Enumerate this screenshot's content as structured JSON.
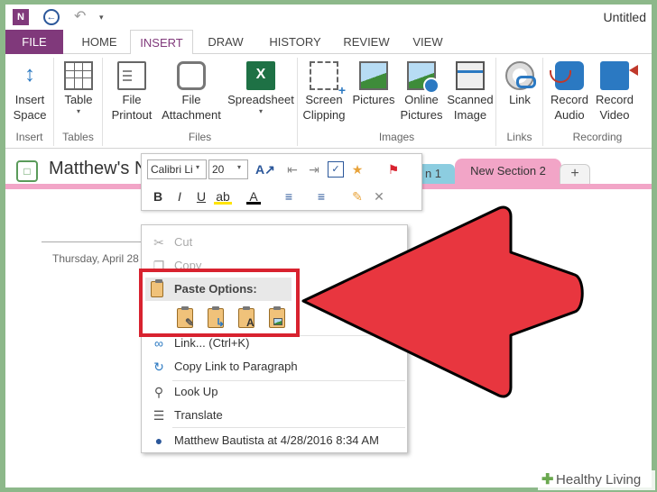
{
  "app": {
    "logo": "N",
    "title": "Untitled"
  },
  "tabs": [
    "FILE",
    "HOME",
    "INSERT",
    "DRAW",
    "HISTORY",
    "REVIEW",
    "VIEW"
  ],
  "ribbon": {
    "groups": {
      "insert": "Insert",
      "tables": "Tables",
      "files": "Files",
      "images": "Images",
      "links": "Links",
      "recording": "Recording"
    },
    "buttons": {
      "insert_space": [
        "Insert",
        "Space"
      ],
      "table": [
        "Table"
      ],
      "file_printout": [
        "File",
        "Printout"
      ],
      "file_attachment": [
        "File",
        "Attachment"
      ],
      "spreadsheet": [
        "Spreadsheet"
      ],
      "screen_clipping": [
        "Screen",
        "Clipping"
      ],
      "pictures": [
        "Pictures"
      ],
      "online_pictures": [
        "Online",
        "Pictures"
      ],
      "scanned_image": [
        "Scanned",
        "Image"
      ],
      "link": [
        "Link"
      ],
      "record_audio": [
        "Record",
        "Audio"
      ],
      "record_video": [
        "Record",
        "Video"
      ]
    }
  },
  "notebook": {
    "title": "Matthew's N",
    "section_tab_1": "n 1",
    "section_tab_2": "New Section 2",
    "add_tab": "+"
  },
  "page": {
    "date": "Thursday, April 28"
  },
  "mini_toolbar": {
    "font": "Calibri Li",
    "size": "20"
  },
  "context_menu": {
    "cut": "Cut",
    "copy": "Copy",
    "paste_options": "Paste Options:",
    "link": "Link...  (Ctrl+K)",
    "copy_link": "Copy Link to Paragraph",
    "look_up": "Look Up",
    "translate": "Translate",
    "author": "Matthew Bautista at 4/28/2016 8:34 AM"
  },
  "watermark": {
    "text": "Healthy Living"
  },
  "colors": {
    "onenote_purple": "#80397b",
    "highlight_red": "#d8222f",
    "section_pink": "#f2a5c7",
    "section_blue": "#8ccde0"
  }
}
